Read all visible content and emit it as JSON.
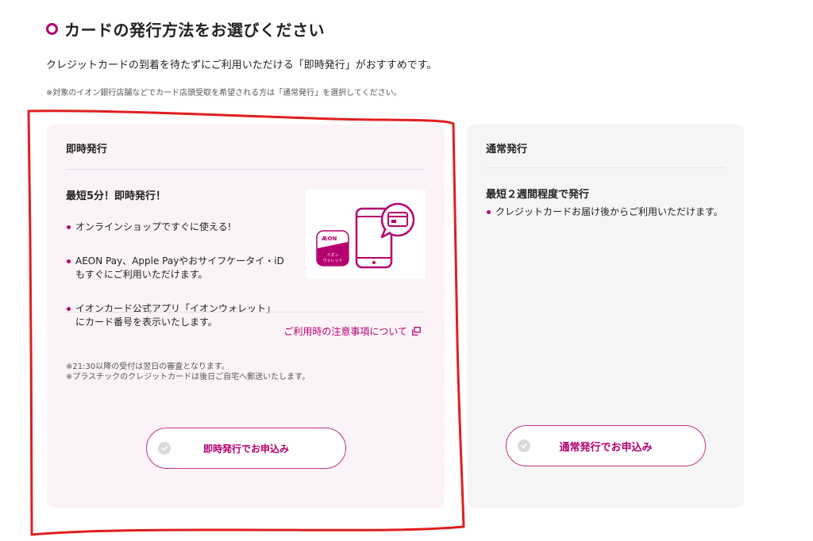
{
  "section": {
    "title": "カードの発行方法をお選びください",
    "lead": "クレジットカードの到着を待たずにご利用いただける「即時発行」がおすすめです。",
    "note": "※対象のイオン銀行店舗などでカード店頭受取を希望される方は「通常発行」を選択してください。"
  },
  "instant": {
    "heading": "即時発行",
    "feature_title": "最短5分！即時発行！",
    "bullets": [
      "オンラインショップですぐに使える!",
      "AEON Pay、Apple Payやおサイフケータイ・iD\nもすぐにご利用いただけます。",
      "イオンカード公式アプリ「イオンウォレット」\nにカード番号を表示いたします。"
    ],
    "illustration": {
      "app_logo_text": "ÆON",
      "app_label_line1": "イオン",
      "app_label_line2": "ウォレット"
    },
    "notice_link": "ご利用時の注意事項について",
    "footnotes": [
      "※21:30以降の受付は翌日の審査となります。",
      "※プラスチックのクレジットカードは後日ご自宅へ郵送いたします。"
    ],
    "button_label": "即時発行でお申込み"
  },
  "normal": {
    "heading": "通常発行",
    "feature_title": "最短２週間程度で発行",
    "bullets": [
      "クレジットカードお届け後からご利用いただけます。"
    ],
    "button_label": "通常発行でお申込み"
  },
  "colors": {
    "accent": "#b5006f",
    "instant_bg": "#fcf3f8",
    "normal_bg": "#f5f5f5",
    "annotation": "#e01f1f"
  },
  "icons": {
    "title_marker": "ring-icon",
    "external_link": "external-link-icon",
    "button_check": "check-circle-icon",
    "illustration": "smartphone-card-icon"
  }
}
